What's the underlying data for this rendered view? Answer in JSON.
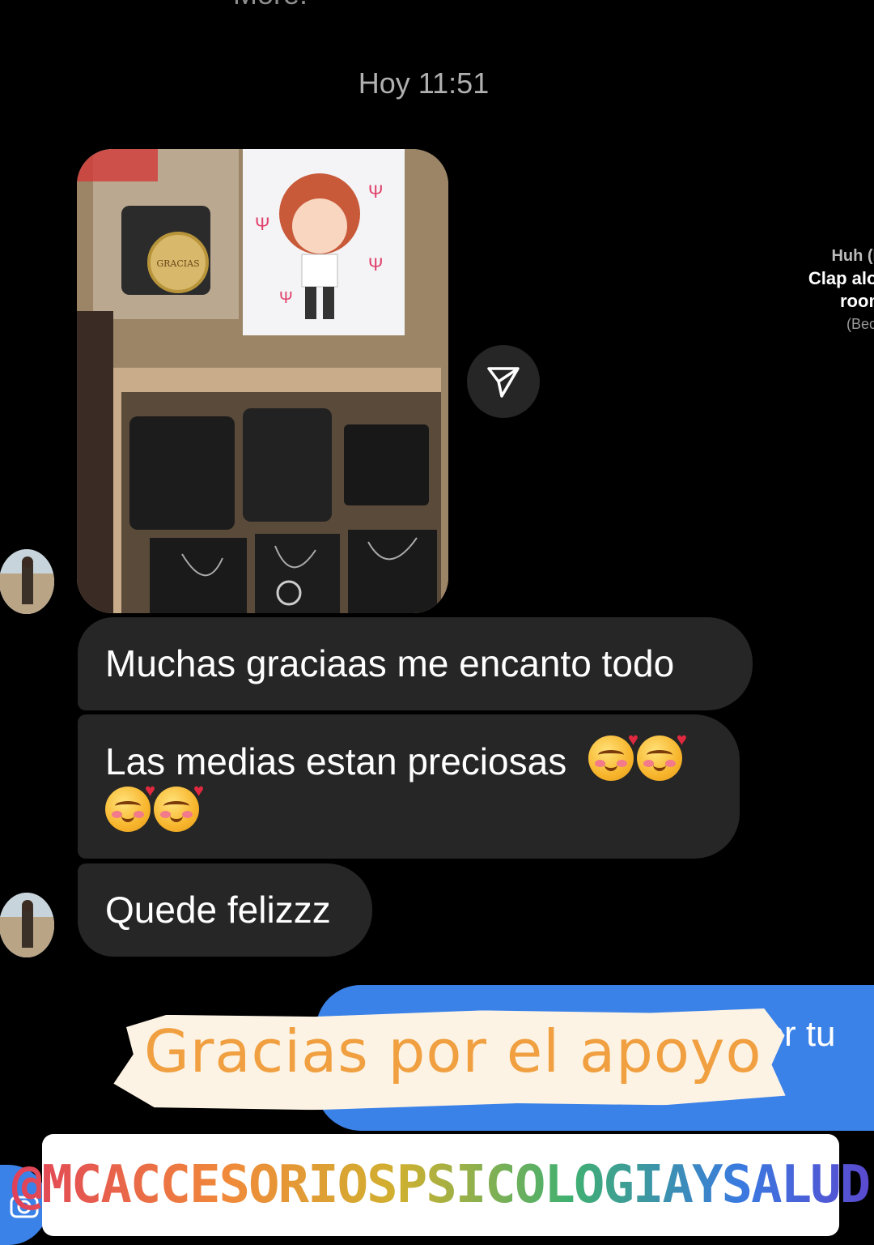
{
  "header": {
    "cut_off_text": "More.",
    "timestamp": "Hoy 11:51"
  },
  "colors": {
    "background": "#000000",
    "incoming_bubble": "#262626",
    "outgoing_bubble": "#3b82e8",
    "sticker_text": "#f0a040"
  },
  "thread": {
    "incoming_messages": [
      {
        "text": "Muchas graciaas me encanto todo"
      },
      {
        "text": "Las medias estan preciosas",
        "emojis": [
          "smiling-face-with-hearts",
          "smiling-face-with-hearts",
          "smiling-face-with-hearts",
          "smiling-face-with-hearts"
        ]
      },
      {
        "text": "Quede felizzz"
      }
    ],
    "outgoing_message": {
      "visible_text": "por tu"
    },
    "photo": {
      "seal_text": "GRACIAS"
    }
  },
  "story_overlay": {
    "sticker_text": "Gracias por el apoyo",
    "mention": "@MCACCESORIOSPSICOLOGIAYSALUD",
    "side_text": {
      "line1": "Huh (B",
      "line2": "Clap alor",
      "line3": "room",
      "line4": "(Beca"
    }
  }
}
